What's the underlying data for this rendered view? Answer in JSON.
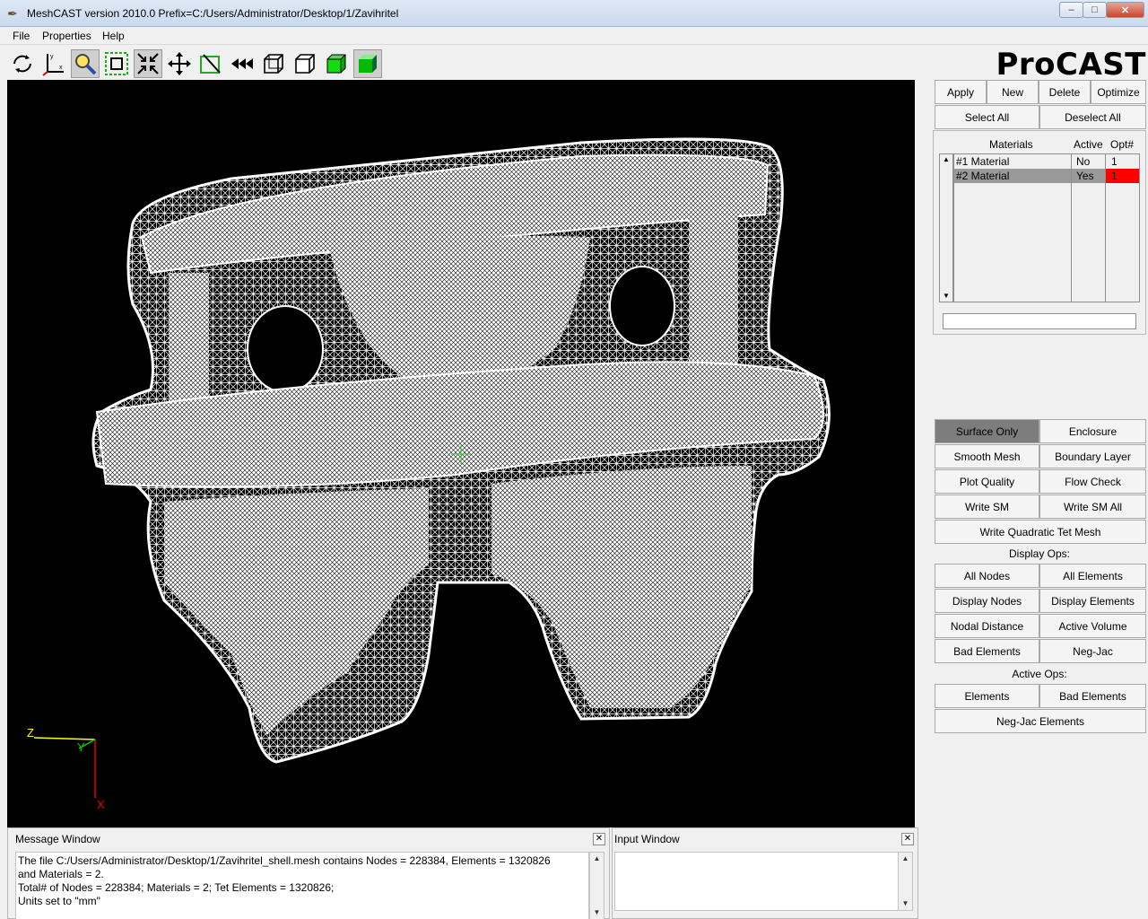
{
  "window": {
    "title": "MeshCAST version 2010.0   Prefix=C:/Users/Administrator/Desktop/1/Zavihritel",
    "minimize": "–",
    "maximize": "□",
    "close": "✕"
  },
  "menu": [
    "File",
    "Properties",
    "Help"
  ],
  "toolbar": {
    "tools": [
      "rotate-icon",
      "axes-icon",
      "zoom-icon",
      "fit-window-icon",
      "shrink-icon",
      "pan-icon",
      "clip-icon",
      "reset-view-icon",
      "wire-cube-icon",
      "hidden-cube-icon",
      "solid-cube-icon",
      "shaded-cube-icon"
    ],
    "pressed": [
      2,
      4,
      11
    ]
  },
  "logo": "ProCAST",
  "axis_triad": {
    "z": "Z",
    "y": "Y",
    "x": "X"
  },
  "panel": {
    "top_buttons": [
      "Apply",
      "New",
      "Delete",
      "Optimize"
    ],
    "select_all": "Select All",
    "deselect_all": "Deselect All",
    "materials_header": {
      "name": "Materials",
      "active": "Active",
      "opt": "Opt#"
    },
    "materials": [
      {
        "name": "#1 Material",
        "active": "No",
        "opt": "1",
        "selected": false
      },
      {
        "name": "#2 Material",
        "active": "Yes",
        "opt": "1",
        "selected": true
      }
    ],
    "surface_only": "Surface Only",
    "enclosure": "Enclosure",
    "smooth_mesh": "Smooth Mesh",
    "boundary_layer": "Boundary Layer",
    "plot_quality": "Plot Quality",
    "flow_check": "Flow Check",
    "write_sm": "Write SM",
    "write_sm_all": "Write SM All",
    "write_quadratic": "Write Quadratic Tet Mesh",
    "display_ops_label": "Display Ops:",
    "all_nodes": "All Nodes",
    "all_elements": "All Elements",
    "display_nodes": "Display Nodes",
    "display_elements": "Display Elements",
    "nodal_distance": "Nodal Distance",
    "active_volume": "Active Volume",
    "bad_elements": "Bad Elements",
    "neg_jac": "Neg-Jac",
    "active_ops_label": "Active Ops:",
    "elements": "Elements",
    "bad_elements_2": "Bad Elements",
    "neg_jac_elements": "Neg-Jac Elements"
  },
  "message_window": {
    "title": "Message Window",
    "lines": [
      "The file C:/Users/Administrator/Desktop/1/Zavihritel_shell.mesh contains Nodes = 228384, Elements = 1320826",
      "and Materials = 2.",
      "Total# of Nodes = 228384; Materials = 2; Tet Elements = 1320826;",
      "Units set to \"mm\""
    ]
  },
  "input_window": {
    "title": "Input Window",
    "value": ""
  },
  "colors": {
    "selected_row": "#9a9a9a",
    "opt_highlight": "#ff0000",
    "viewport_bg": "#000000",
    "mesh": "#ffffff"
  }
}
